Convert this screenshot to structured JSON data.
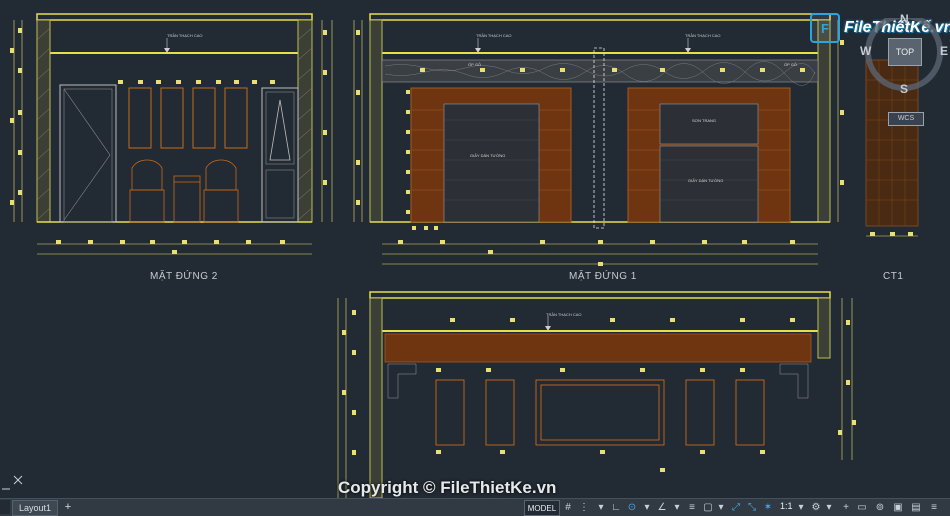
{
  "drawing": {
    "views": [
      {
        "id": "mat-dung-2",
        "label": "MẶT ĐỨNG 2"
      },
      {
        "id": "mat-dung-1",
        "label": "MẶT ĐỨNG 1"
      },
      {
        "id": "ct1",
        "label": "CT1"
      }
    ],
    "annotations": {
      "ceiling": "TRẦN THẠCH CAO",
      "wall_paper": "GIẤY DÁN TƯỜNG",
      "painting": "SƠN TRANG",
      "wood_trim": "ỐP GỖ"
    }
  },
  "watermark": {
    "logo_text": "FileThiếtKế.vn",
    "logo_box": "F",
    "copyright": "Copyright © FileThietKe.vn"
  },
  "viewcube": {
    "n": "N",
    "s": "S",
    "e": "E",
    "w": "W",
    "top": "TOP",
    "wcs": "WCS"
  },
  "statusbar": {
    "model_tab": "",
    "layout_tab": "Layout1",
    "add_tab": "+",
    "model_button": "MODEL",
    "scale": "1:1",
    "icons": [
      "grid-icon",
      "snap-icon",
      "ortho-icon",
      "polar-icon",
      "isodraft-icon",
      "osnap-icon",
      "otrack-icon",
      "lineweight-icon",
      "transparency-icon",
      "selection-cycling-icon",
      "annotation-visibility-icon",
      "auto-scale-icon",
      "annotation-scale-icon",
      "workspace-gear-icon",
      "add-icon",
      "isolate-icon",
      "hardware-accel-icon",
      "clean-screen-icon",
      "customize-icon"
    ]
  },
  "colors": {
    "background": "#222a33",
    "wall": "#e5e04a",
    "wood": "#7a3a10",
    "dimension": "#e8e070",
    "line": "#c9c9c9"
  }
}
